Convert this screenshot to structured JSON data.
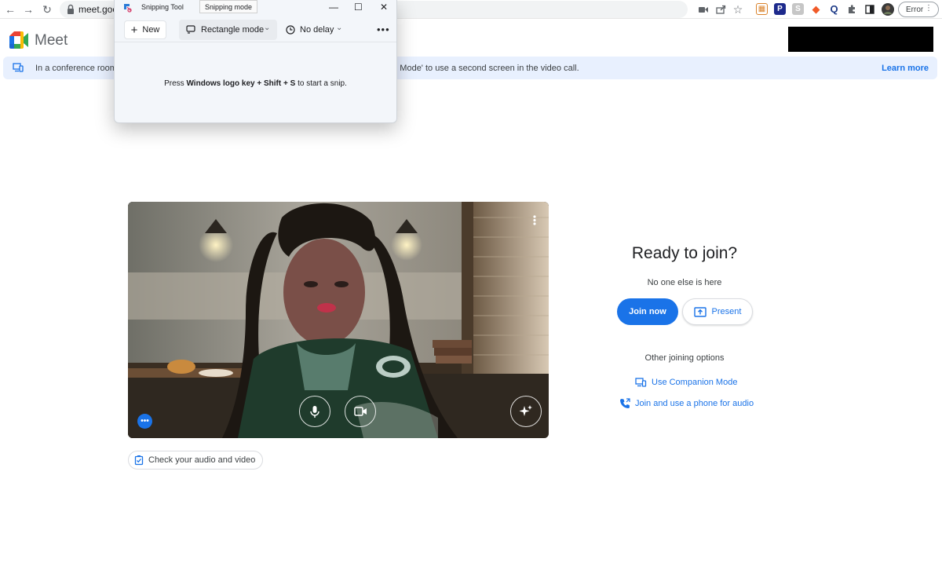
{
  "browser": {
    "url": "meet.goog",
    "error_label": "Error",
    "extensions": [
      {
        "name": "grid-ext-icon",
        "glyph": "▦",
        "color": "#d9822b"
      },
      {
        "name": "p-ext-icon",
        "glyph": "P",
        "color": "#1d2a8c"
      },
      {
        "name": "s-ext-icon",
        "glyph": "S",
        "color": "#c6c6c6"
      },
      {
        "name": "orange-ext-icon",
        "glyph": "◆",
        "color": "#f05a28"
      },
      {
        "name": "q-ext-icon",
        "glyph": "Q",
        "color": "#1f3c88"
      }
    ]
  },
  "meet": {
    "title": "Meet"
  },
  "banner": {
    "text_left": "In a conference room",
    "text_right": "on Mode' to use a second screen in the video call.",
    "learn_more": "Learn more"
  },
  "snipping_tool": {
    "app_name": "Snipping Tool",
    "tooltip": "Snipping mode",
    "new_label": "New",
    "mode_label": "Rectangle mode",
    "delay_label": "No delay",
    "hint_prefix": "Press ",
    "hint_keys_1": "Windows logo key",
    "hint_plus_1": " + ",
    "hint_keys_2": "Shift",
    "hint_plus_2": " + ",
    "hint_keys_3": "S",
    "hint_suffix": " to start a snip."
  },
  "preview": {
    "check_label": "Check your audio and video"
  },
  "join_panel": {
    "heading": "Ready to join?",
    "subheading": "No one else is here",
    "join_label": "Join now",
    "present_label": "Present",
    "other_options": "Other joining options",
    "companion_label": "Use Companion Mode",
    "phone_label": "Join and use a phone for audio"
  },
  "colors": {
    "accent": "#1a73e8",
    "banner_bg": "#e8f0fe"
  }
}
